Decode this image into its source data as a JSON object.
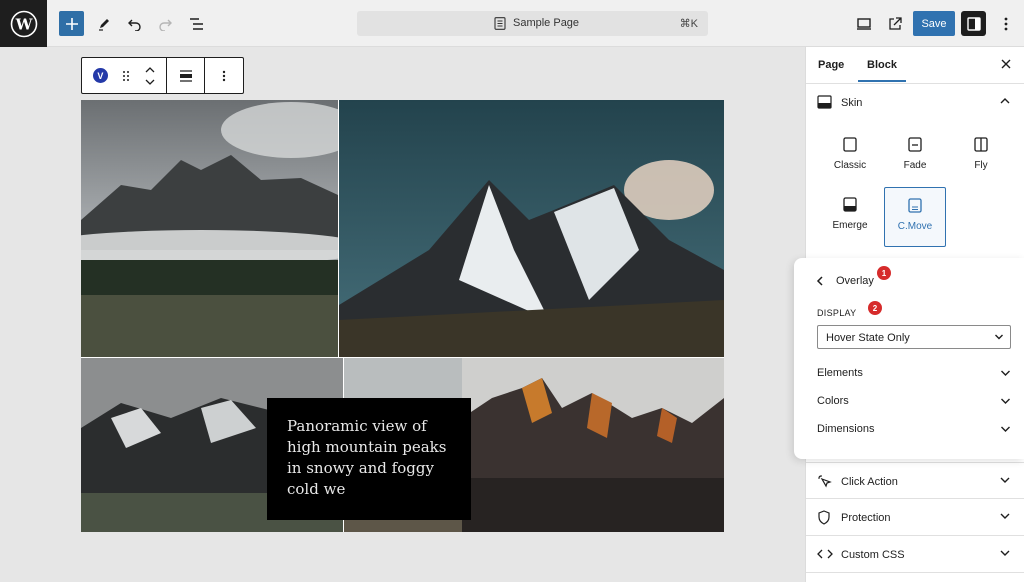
{
  "topbar": {
    "document_title": "Sample Page",
    "shortcut": "⌘K",
    "save_label": "Save"
  },
  "block_toolbar": {
    "block_badge": "V"
  },
  "gallery": {
    "caption": "Panoramic view of high mountain peaks in snowy and foggy cold we"
  },
  "sidebar": {
    "tabs": [
      {
        "label": "Page"
      },
      {
        "label": "Block"
      }
    ],
    "skin": {
      "title": "Skin",
      "options": [
        {
          "label": "Classic",
          "icon": "classic-icon"
        },
        {
          "label": "Fade",
          "icon": "fade-icon"
        },
        {
          "label": "Fly",
          "icon": "fly-icon"
        },
        {
          "label": "Emerge",
          "icon": "emerge-icon"
        },
        {
          "label": "C.Move",
          "icon": "cmove-icon",
          "selected": true
        }
      ]
    },
    "overlay": {
      "title": "Overlay",
      "display_label": "DISPLAY",
      "display_value": "Hover State Only",
      "rows": [
        {
          "label": "Elements"
        },
        {
          "label": "Colors"
        },
        {
          "label": "Dimensions"
        }
      ],
      "badges": [
        "1",
        "2"
      ],
      "badge_color": "#d62b2b"
    },
    "panels": [
      {
        "label": "Click Action",
        "icon": "pointer-icon"
      },
      {
        "label": "Protection",
        "icon": "shield-icon"
      },
      {
        "label": "Custom CSS",
        "icon": "code-icon"
      }
    ]
  },
  "colors": {
    "accent": "#3072b0",
    "save": "#3072b0",
    "add_button": "#2f6fa7"
  }
}
